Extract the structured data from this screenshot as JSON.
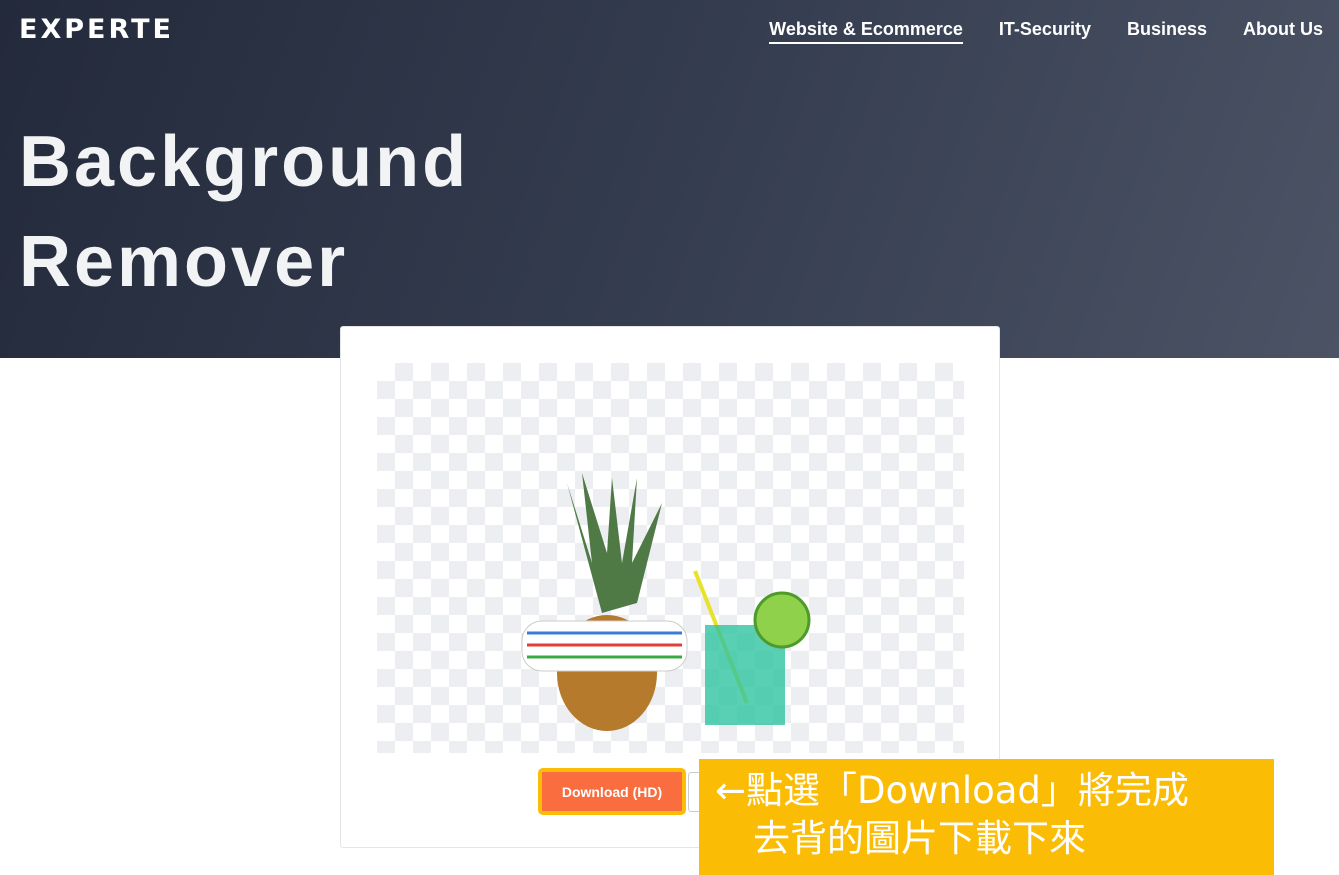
{
  "header": {
    "logo": "EXPERTE",
    "nav": [
      "Website & Ecommerce",
      "IT-Security",
      "Business",
      "About Us"
    ]
  },
  "hero": {
    "title_line1": "Background",
    "title_line2": "Remover"
  },
  "tool": {
    "download_label": "Download (HD)"
  },
  "annotation": {
    "line1": "←點選「Download」將完成",
    "line2": "去背的圖片下載下來"
  },
  "colors": {
    "accent": "#f96d3f",
    "highlight": "#fbbc05"
  }
}
